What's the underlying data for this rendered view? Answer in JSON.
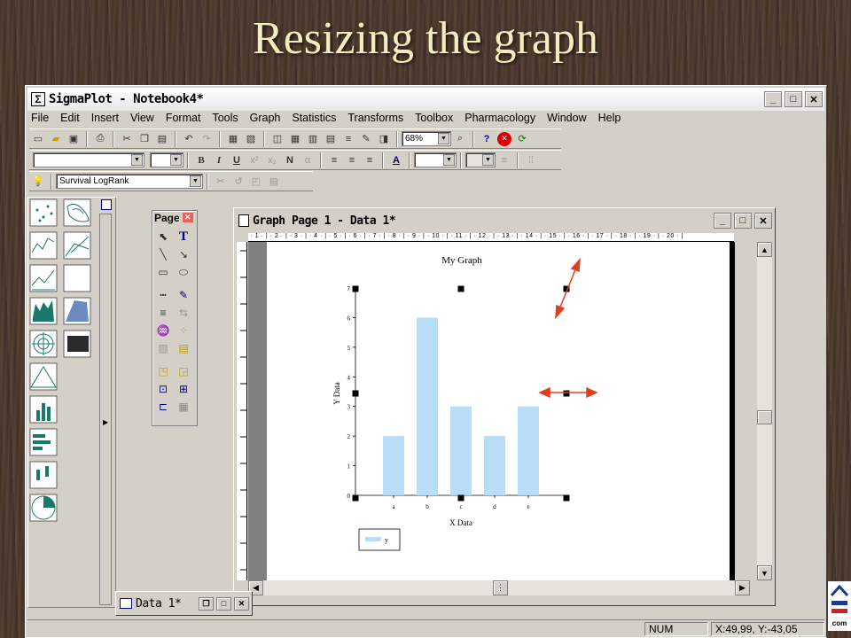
{
  "slide": {
    "title": "Resizing the graph"
  },
  "app": {
    "title": "SigmaPlot - Notebook4*",
    "menu": [
      "File",
      "Edit",
      "Insert",
      "View",
      "Format",
      "Tools",
      "Graph",
      "Statistics",
      "Transforms",
      "Toolbox",
      "Pharmacology",
      "Window",
      "Help"
    ],
    "zoom": "68%",
    "test_select": "Survival LogRank",
    "status_num": "NUM",
    "status_coords": "X:49,99, Y:-43,05"
  },
  "page_tools": {
    "title": "Page"
  },
  "graph_window": {
    "title": "Graph Page 1 - Data 1*"
  },
  "data_window": {
    "title": "Data 1*"
  },
  "chart_data": {
    "type": "bar",
    "title": "My Graph",
    "xlabel": "X Data",
    "ylabel": "Y Data",
    "categories": [
      "a",
      "b",
      "c",
      "d",
      "e"
    ],
    "series": [
      {
        "name": "y",
        "values": [
          2,
          6,
          3,
          2,
          3
        ]
      }
    ],
    "ylim": [
      0,
      7
    ],
    "yticks": [
      "0",
      "1",
      "2",
      "3",
      "4",
      "5",
      "6",
      "7"
    ],
    "legend": "bottom-left",
    "bar_color": "#b9dcf7"
  }
}
